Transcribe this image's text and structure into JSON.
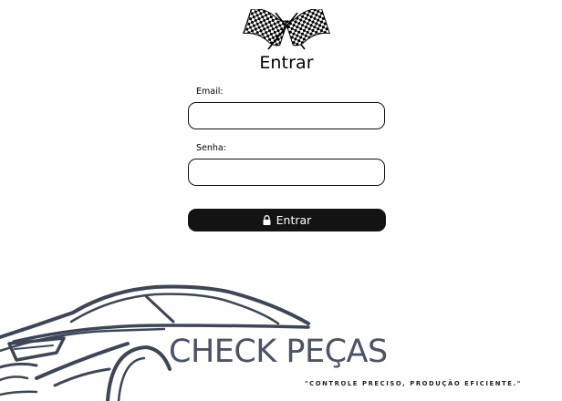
{
  "header": {
    "logo_icon": "checkered-flags-icon",
    "title": "Entrar"
  },
  "form": {
    "email_label": "Email:",
    "email_value": "",
    "password_label": "Senha:",
    "password_value": "",
    "submit_label": "Entrar",
    "submit_icon": "lock-icon"
  },
  "brand": {
    "name": "CHECK PEÇAS",
    "tagline": "\"CONTROLE PRECISO, PRODUÇÃO EFICIENTE.\"",
    "color": "#4a5466",
    "art_icon": "car-silhouette"
  },
  "colors": {
    "button_bg": "#131313",
    "button_text": "#ffffff",
    "input_border": "#111111"
  }
}
